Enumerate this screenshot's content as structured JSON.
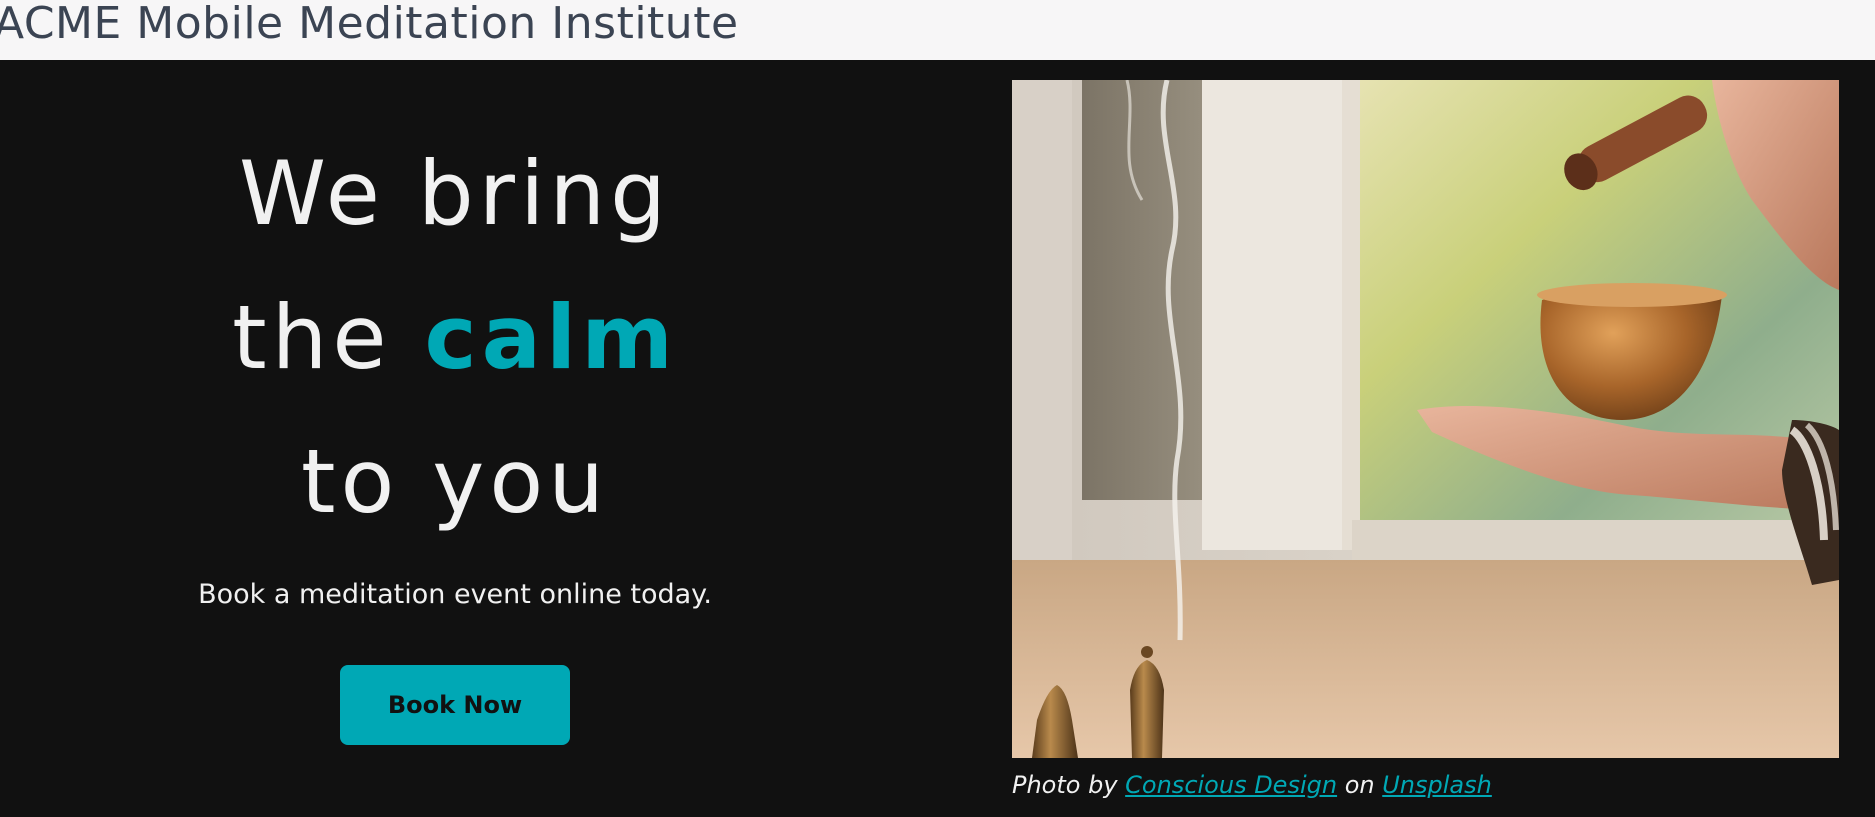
{
  "header": {
    "site_title": "ACME Mobile Meditation Institute"
  },
  "hero": {
    "headline": {
      "line1": "We bring",
      "line2_prefix": "the ",
      "line2_accent": "calm",
      "line3": "to you"
    },
    "subtitle": "Book a meditation event online today.",
    "cta_label": "Book Now",
    "photo": {
      "alt": "Hand holding a brass singing bowl and mallet beside burning incense",
      "caption_prefix": "Photo by ",
      "photographer": "Conscious Design",
      "caption_middle": " on ",
      "source": "Unsplash"
    }
  },
  "colors": {
    "accent": "#00a8b5",
    "background": "#111111",
    "text": "#f1f1f1",
    "header_bg": "#f7f6f7",
    "header_text": "#3b4453"
  }
}
